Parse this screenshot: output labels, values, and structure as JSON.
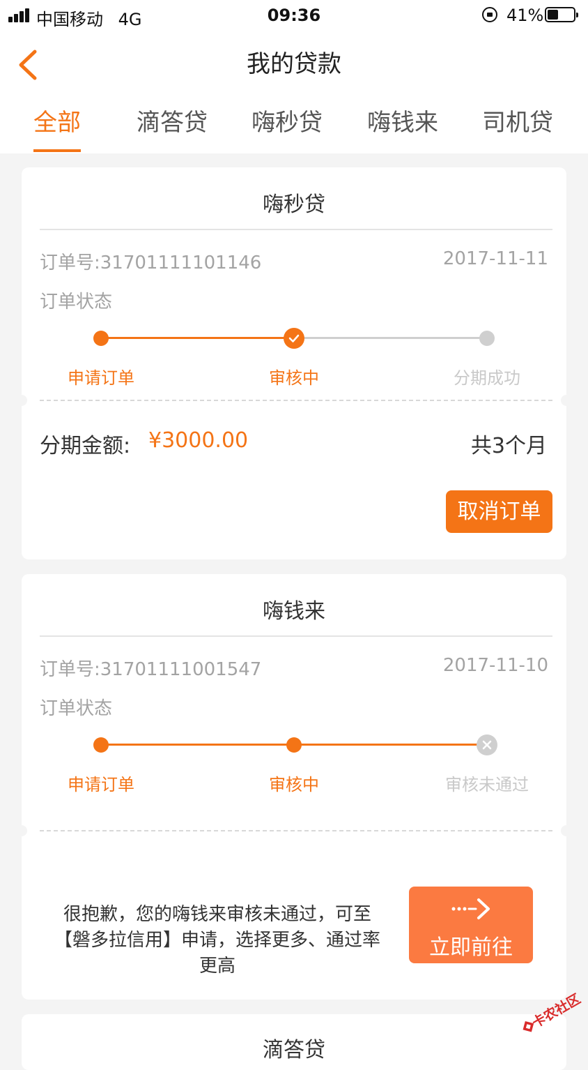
{
  "status_bar": {
    "carrier": "中国移动",
    "network": "4G",
    "time": "09:36",
    "battery_percent_label": "41%",
    "battery_level": 0.41
  },
  "nav": {
    "title": "我的贷款",
    "back_icon": "chevron-left-icon"
  },
  "tabs": [
    {
      "label": "全部",
      "active": true
    },
    {
      "label": "滴答贷",
      "active": false
    },
    {
      "label": "嗨秒贷",
      "active": false
    },
    {
      "label": "嗨钱来",
      "active": false
    },
    {
      "label": "司机贷",
      "active": false
    }
  ],
  "orders": [
    {
      "product": "嗨秒贷",
      "order_no": "订单号:31701111101146",
      "date": "2017-11-11",
      "status_label": "订单状态",
      "steps": [
        {
          "label": "申请订单",
          "state": "done"
        },
        {
          "label": "审核中",
          "state": "current"
        },
        {
          "label": "分期成功",
          "state": "pending"
        }
      ],
      "amount_label": "分期金额:",
      "amount": "¥3000.00",
      "term": "共3个月",
      "cancel_label": "取消订单"
    },
    {
      "product": "嗨钱来",
      "order_no": "订单号:31701111001547",
      "date": "2017-11-10",
      "status_label": "订单状态",
      "steps": [
        {
          "label": "申请订单",
          "state": "done"
        },
        {
          "label": "审核中",
          "state": "done"
        },
        {
          "label": "审核未通过",
          "state": "failed"
        }
      ],
      "notice": "很抱歉，您的嗨钱来审核未通过，可至【磐多拉信用】申请，选择更多、通过率更高",
      "goto_label": "立即前往"
    },
    {
      "product": "滴答贷"
    }
  ],
  "watermark": "卡农社区",
  "colors": {
    "accent": "#f47416",
    "goto_button": "#fb7a41",
    "muted_text": "#a3a3a3",
    "inactive_step": "#cfcfcf",
    "background": "#f4f4f4"
  }
}
